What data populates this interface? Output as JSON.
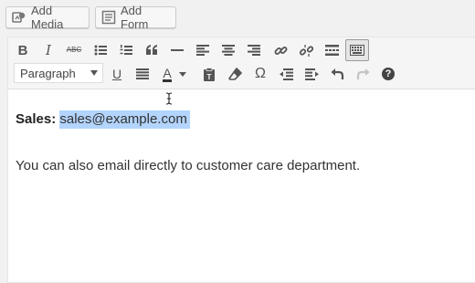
{
  "media_buttons": {
    "add_media": "Add Media",
    "add_form": "Add Form"
  },
  "toolbar": {
    "row1": [
      "bold",
      "italic",
      "strikethrough",
      "bullet-list",
      "numbered-list",
      "blockquote",
      "horizontal-line",
      "align-left",
      "align-center",
      "align-right",
      "insert-link",
      "remove-link",
      "read-more",
      "toolbar-toggle"
    ],
    "row2": [
      "underline",
      "justify",
      "text-color",
      "paste-as-text",
      "clear-formatting",
      "special-character",
      "outdent",
      "indent",
      "undo",
      "redo",
      "help"
    ],
    "bold_glyph": "B",
    "italic_glyph": "I",
    "strike_glyph": "ABC",
    "underline_glyph": "U",
    "text_color_glyph": "A",
    "special_char_glyph": "Ω",
    "help_glyph": "?",
    "format_select": "Paragraph"
  },
  "content": {
    "line1_label": "Sales:",
    "line1_email": "sales@example.com",
    "line2": "You can also email directly to customer care department."
  },
  "colors": {
    "selection": "#b3d4fc",
    "toolbar_bg": "#f5f5f5",
    "icon": "#555555"
  }
}
